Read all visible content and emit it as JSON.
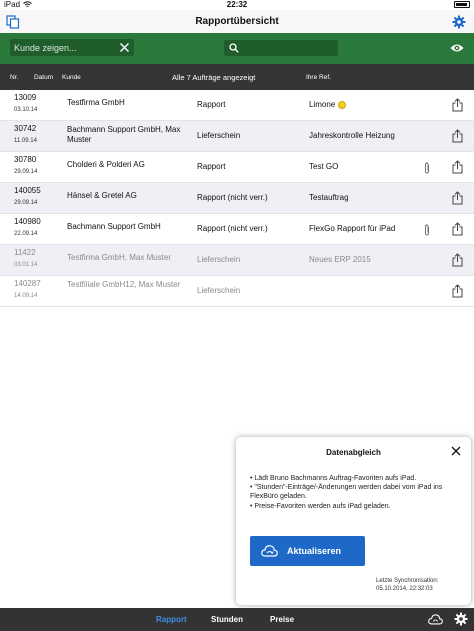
{
  "statusbar": {
    "device": "iPad",
    "time": "22:32"
  },
  "navbar": {
    "title": "Rapportübersicht"
  },
  "search": {
    "placeholder": "Kunde zeigen..."
  },
  "header": {
    "nr": "Nr.",
    "datum": "Datum",
    "kunde": "Kunde",
    "count": "Alle 7 Aufträge angezeigt",
    "ref": "Ihre Ref."
  },
  "rows": [
    {
      "nr": "13009",
      "date": "03.10.14",
      "kunde": "Testfirma GmbH",
      "typ": "Rapport",
      "ref": "Limone",
      "lemon": true,
      "clip": false,
      "dim": false
    },
    {
      "nr": "30742",
      "date": "11.09.14",
      "kunde": "Bachmann Support GmbH, Max Muster",
      "typ": "Lieferschein",
      "ref": "Jahreskontrolle Heizung",
      "lemon": false,
      "clip": false,
      "dim": false
    },
    {
      "nr": "30780",
      "date": "29.09.14",
      "kunde": "Cholderi & Polderi AG",
      "typ": "Rapport",
      "ref": "Test GO",
      "lemon": false,
      "clip": true,
      "dim": false
    },
    {
      "nr": "140055",
      "date": "29.09.14",
      "kunde": "Hänsel & Gretel AG",
      "typ": "Rapport (nicht verr.)",
      "ref": "Testauftrag",
      "lemon": false,
      "clip": false,
      "dim": false
    },
    {
      "nr": "140980",
      "date": "22.09.14",
      "kunde": "Bachmann Support GmbH",
      "typ": "Rapport (nicht verr.)",
      "ref": "FlexGo Rapport für iPad",
      "lemon": false,
      "clip": true,
      "dim": false
    },
    {
      "nr": "11422",
      "date": "03.01.14",
      "kunde": "Testfirma GmbH, Max Muster",
      "typ": "Lieferschein",
      "ref": "Neues ERP 2015",
      "lemon": false,
      "clip": false,
      "dim": true
    },
    {
      "nr": "140287",
      "date": "14.09.14",
      "kunde": "Testfiliale GmbH12, Max Muster",
      "typ": "Lieferschein",
      "ref": "",
      "lemon": false,
      "clip": false,
      "dim": true
    }
  ],
  "popup": {
    "title": "Datenabgleich",
    "lines": [
      "• Lädt Bruno Bachmanns Auftrag-Favoriten aufs iPad.",
      "• \"Stunden\"-Einträge/-Änderungen werden dabei vom iPad ins FlexBüro geladen.",
      "• Preise-Favoriten werden aufs iPad geladen."
    ],
    "button": "Aktualiseren",
    "sync_label": "Letzte Synchronisation:",
    "sync_time": "05.10.2014, 22:32:03"
  },
  "tabs": [
    {
      "label": "Rapport",
      "active": true
    },
    {
      "label": "Stunden",
      "active": false
    },
    {
      "label": "Preise",
      "active": false
    }
  ],
  "colors": {
    "green": "#2c7a3b",
    "accent": "#1e69c8",
    "tab_active": "#3e8ee9"
  }
}
